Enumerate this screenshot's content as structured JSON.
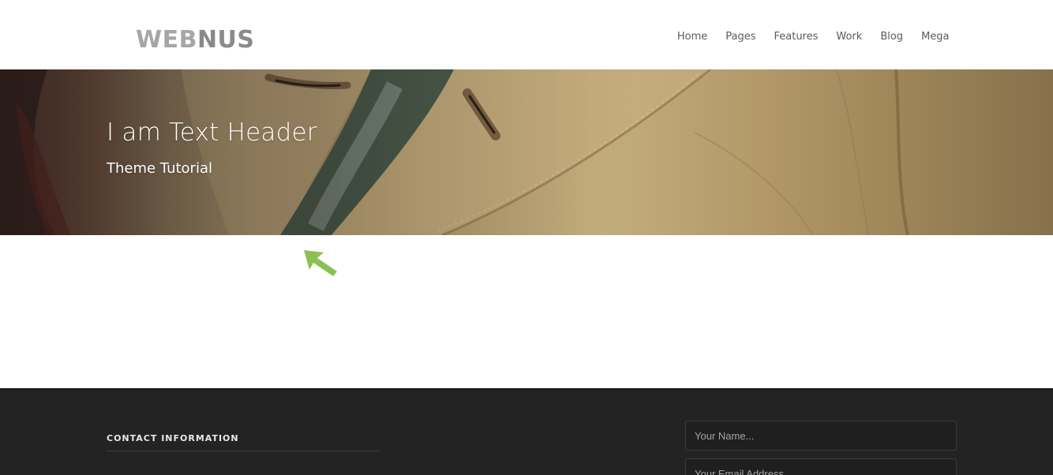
{
  "header": {
    "logo_part1": "WEB",
    "logo_part2": "NUS",
    "nav": [
      "Home",
      "Pages",
      "Features",
      "Work",
      "Blog",
      "Mega"
    ]
  },
  "hero": {
    "title": "I am Text Header",
    "subtitle": "Theme Tutorial"
  },
  "annotation": {
    "arrow_color": "#8cc152",
    "arrow_icon": "arrow-up-left-icon"
  },
  "footer": {
    "contact_heading": "CONTACT INFORMATION",
    "name_placeholder": "Your Name...",
    "email_placeholder": "Your Email Address..."
  },
  "colors": {
    "footer_bg": "#232323",
    "nav_text": "#5a5a5a"
  }
}
